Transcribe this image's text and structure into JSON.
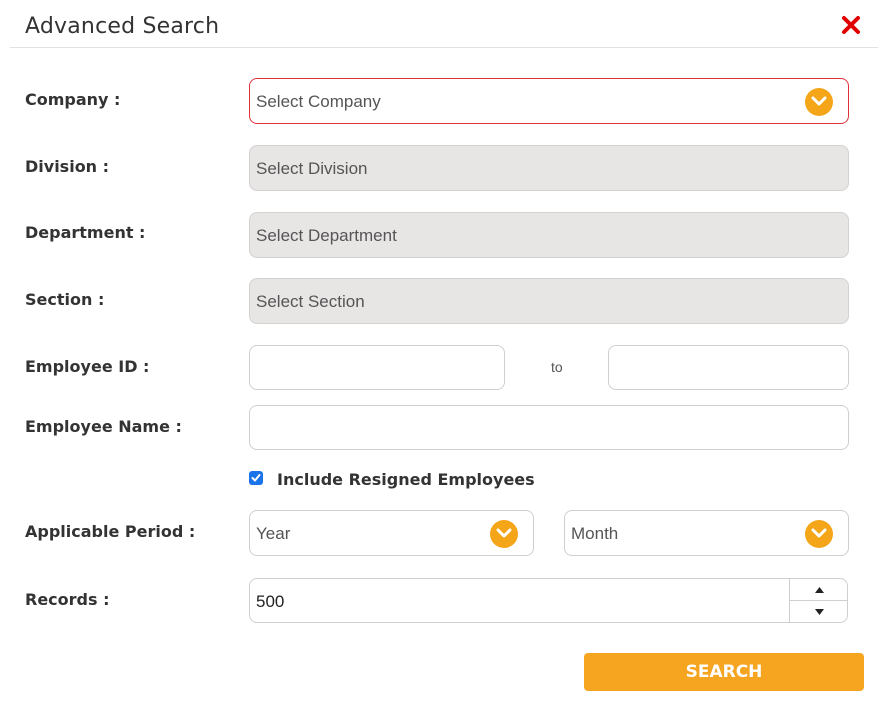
{
  "dialog": {
    "title": "Advanced Search",
    "close_icon": "close-icon"
  },
  "colors": {
    "accent": "#f5a518",
    "close_red": "#e00000",
    "invalid_border": "#e0313b",
    "disabled_bg": "#e8e5e5",
    "checkbox_blue": "#1a73e8"
  },
  "fields": {
    "company": {
      "label": "Company :",
      "value": "Select Company"
    },
    "division": {
      "label": "Division :",
      "value": "Select Division"
    },
    "department": {
      "label": "Department :",
      "value": "Select Department"
    },
    "section": {
      "label": "Section :",
      "value": "Select Section"
    },
    "employee_id": {
      "label": "Employee ID :",
      "from_value": "",
      "to_label": "to",
      "to_value": ""
    },
    "employee_name": {
      "label": "Employee Name :",
      "value": ""
    },
    "include_resigned": {
      "label": "Include Resigned Employees",
      "checked": true
    },
    "applicable_period": {
      "label": "Applicable Period :",
      "year_value": "Year",
      "month_value": "Month"
    },
    "records": {
      "label": "Records :",
      "value": "500"
    }
  },
  "search_button": {
    "label": "SEARCH"
  }
}
